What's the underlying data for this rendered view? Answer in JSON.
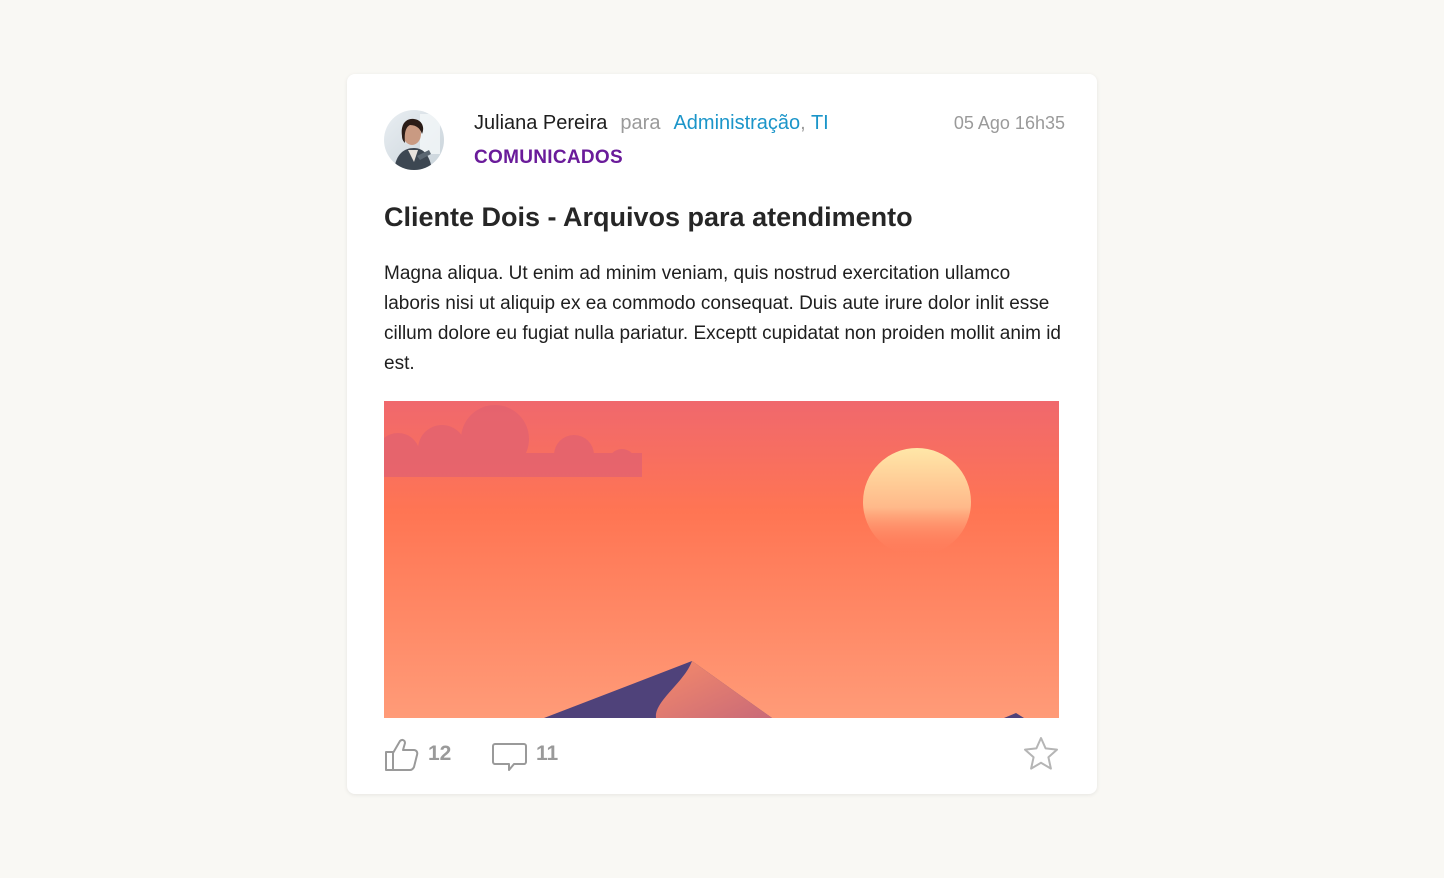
{
  "post": {
    "author": "Juliana Pereira",
    "to_label": "para",
    "recipients": [
      "Administração",
      "TI"
    ],
    "recipient_separator": ",",
    "timestamp": "05 Ago 16h35",
    "category": "COMUNICADOS",
    "title": "Cliente Dois - Arquivos para atendimento",
    "body": "Magna aliqua. Ut enim ad minim veniam, quis nostrud exercitation ullamco laboris nisi ut aliquip ex ea commodo consequat. Duis aute irure dolor inlit esse cillum dolore eu fugiat nulla pariatur. Exceptt cupidatat non proiden mollit anim id est."
  },
  "actions": {
    "likes": "12",
    "comments": "11",
    "like_icon": "thumbs-up-icon",
    "comment_icon": "comment-icon",
    "favorite_icon": "star-icon"
  },
  "colors": {
    "background": "#f9f8f4",
    "recipient_link": "#1b95c9",
    "category": "#6a1b9a",
    "muted": "#9a9a9a"
  }
}
